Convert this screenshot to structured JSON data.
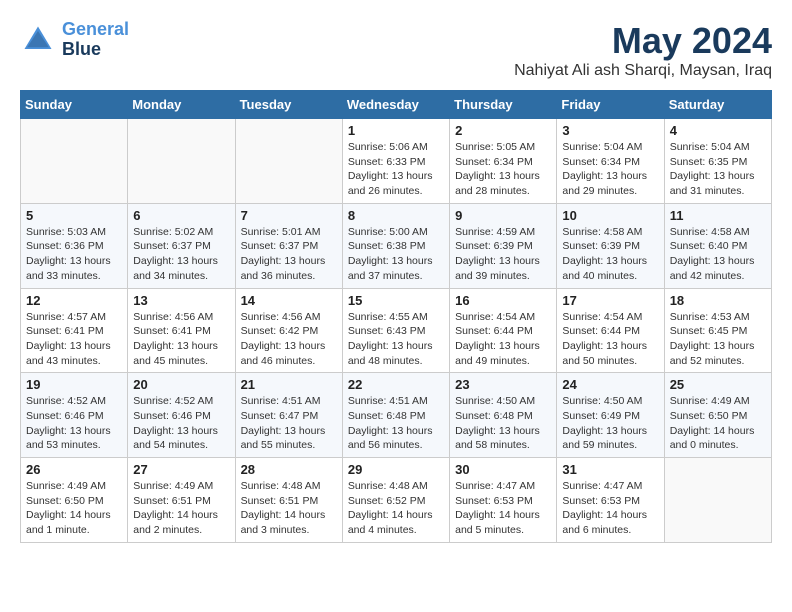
{
  "logo": {
    "line1": "General",
    "line2": "Blue"
  },
  "title": "May 2024",
  "location": "Nahiyat Ali ash Sharqi, Maysan, Iraq",
  "days_header": [
    "Sunday",
    "Monday",
    "Tuesday",
    "Wednesday",
    "Thursday",
    "Friday",
    "Saturday"
  ],
  "weeks": [
    [
      {
        "day": "",
        "info": ""
      },
      {
        "day": "",
        "info": ""
      },
      {
        "day": "",
        "info": ""
      },
      {
        "day": "1",
        "info": "Sunrise: 5:06 AM\nSunset: 6:33 PM\nDaylight: 13 hours\nand 26 minutes."
      },
      {
        "day": "2",
        "info": "Sunrise: 5:05 AM\nSunset: 6:34 PM\nDaylight: 13 hours\nand 28 minutes."
      },
      {
        "day": "3",
        "info": "Sunrise: 5:04 AM\nSunset: 6:34 PM\nDaylight: 13 hours\nand 29 minutes."
      },
      {
        "day": "4",
        "info": "Sunrise: 5:04 AM\nSunset: 6:35 PM\nDaylight: 13 hours\nand 31 minutes."
      }
    ],
    [
      {
        "day": "5",
        "info": "Sunrise: 5:03 AM\nSunset: 6:36 PM\nDaylight: 13 hours\nand 33 minutes."
      },
      {
        "day": "6",
        "info": "Sunrise: 5:02 AM\nSunset: 6:37 PM\nDaylight: 13 hours\nand 34 minutes."
      },
      {
        "day": "7",
        "info": "Sunrise: 5:01 AM\nSunset: 6:37 PM\nDaylight: 13 hours\nand 36 minutes."
      },
      {
        "day": "8",
        "info": "Sunrise: 5:00 AM\nSunset: 6:38 PM\nDaylight: 13 hours\nand 37 minutes."
      },
      {
        "day": "9",
        "info": "Sunrise: 4:59 AM\nSunset: 6:39 PM\nDaylight: 13 hours\nand 39 minutes."
      },
      {
        "day": "10",
        "info": "Sunrise: 4:58 AM\nSunset: 6:39 PM\nDaylight: 13 hours\nand 40 minutes."
      },
      {
        "day": "11",
        "info": "Sunrise: 4:58 AM\nSunset: 6:40 PM\nDaylight: 13 hours\nand 42 minutes."
      }
    ],
    [
      {
        "day": "12",
        "info": "Sunrise: 4:57 AM\nSunset: 6:41 PM\nDaylight: 13 hours\nand 43 minutes."
      },
      {
        "day": "13",
        "info": "Sunrise: 4:56 AM\nSunset: 6:41 PM\nDaylight: 13 hours\nand 45 minutes."
      },
      {
        "day": "14",
        "info": "Sunrise: 4:56 AM\nSunset: 6:42 PM\nDaylight: 13 hours\nand 46 minutes."
      },
      {
        "day": "15",
        "info": "Sunrise: 4:55 AM\nSunset: 6:43 PM\nDaylight: 13 hours\nand 48 minutes."
      },
      {
        "day": "16",
        "info": "Sunrise: 4:54 AM\nSunset: 6:44 PM\nDaylight: 13 hours\nand 49 minutes."
      },
      {
        "day": "17",
        "info": "Sunrise: 4:54 AM\nSunset: 6:44 PM\nDaylight: 13 hours\nand 50 minutes."
      },
      {
        "day": "18",
        "info": "Sunrise: 4:53 AM\nSunset: 6:45 PM\nDaylight: 13 hours\nand 52 minutes."
      }
    ],
    [
      {
        "day": "19",
        "info": "Sunrise: 4:52 AM\nSunset: 6:46 PM\nDaylight: 13 hours\nand 53 minutes."
      },
      {
        "day": "20",
        "info": "Sunrise: 4:52 AM\nSunset: 6:46 PM\nDaylight: 13 hours\nand 54 minutes."
      },
      {
        "day": "21",
        "info": "Sunrise: 4:51 AM\nSunset: 6:47 PM\nDaylight: 13 hours\nand 55 minutes."
      },
      {
        "day": "22",
        "info": "Sunrise: 4:51 AM\nSunset: 6:48 PM\nDaylight: 13 hours\nand 56 minutes."
      },
      {
        "day": "23",
        "info": "Sunrise: 4:50 AM\nSunset: 6:48 PM\nDaylight: 13 hours\nand 58 minutes."
      },
      {
        "day": "24",
        "info": "Sunrise: 4:50 AM\nSunset: 6:49 PM\nDaylight: 13 hours\nand 59 minutes."
      },
      {
        "day": "25",
        "info": "Sunrise: 4:49 AM\nSunset: 6:50 PM\nDaylight: 14 hours\nand 0 minutes."
      }
    ],
    [
      {
        "day": "26",
        "info": "Sunrise: 4:49 AM\nSunset: 6:50 PM\nDaylight: 14 hours\nand 1 minute."
      },
      {
        "day": "27",
        "info": "Sunrise: 4:49 AM\nSunset: 6:51 PM\nDaylight: 14 hours\nand 2 minutes."
      },
      {
        "day": "28",
        "info": "Sunrise: 4:48 AM\nSunset: 6:51 PM\nDaylight: 14 hours\nand 3 minutes."
      },
      {
        "day": "29",
        "info": "Sunrise: 4:48 AM\nSunset: 6:52 PM\nDaylight: 14 hours\nand 4 minutes."
      },
      {
        "day": "30",
        "info": "Sunrise: 4:47 AM\nSunset: 6:53 PM\nDaylight: 14 hours\nand 5 minutes."
      },
      {
        "day": "31",
        "info": "Sunrise: 4:47 AM\nSunset: 6:53 PM\nDaylight: 14 hours\nand 6 minutes."
      },
      {
        "day": "",
        "info": ""
      }
    ]
  ]
}
